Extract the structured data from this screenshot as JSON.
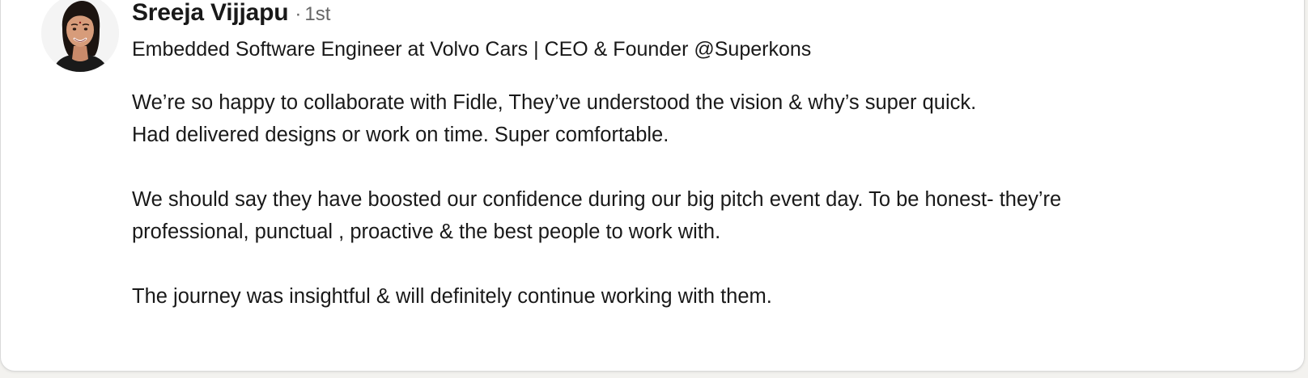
{
  "profile": {
    "name": "Sreeja Vijjapu",
    "separator": "·",
    "degree": "1st",
    "headline": "Embedded Software Engineer at Volvo Cars | CEO & Founder @Superkons",
    "avatar_icon": "profile-photo"
  },
  "testimonial": {
    "paragraphs": [
      {
        "lines": [
          "We’re so happy to collaborate with Fidle, They’ve understood the vision & why’s super quick.",
          "Had delivered designs or work on time. Super comfortable."
        ]
      },
      {
        "lines": [
          "We should say they have boosted our confidence during our big pitch event day. To be honest- they’re",
          "professional, punctual , proactive & the best people to work with."
        ]
      },
      {
        "lines": [
          "The journey was insightful & will definitely continue working with them."
        ]
      }
    ]
  },
  "colors": {
    "card_background": "#ffffff",
    "text_primary": "#191919",
    "text_secondary": "#666666",
    "border": "#d9d9d9"
  }
}
